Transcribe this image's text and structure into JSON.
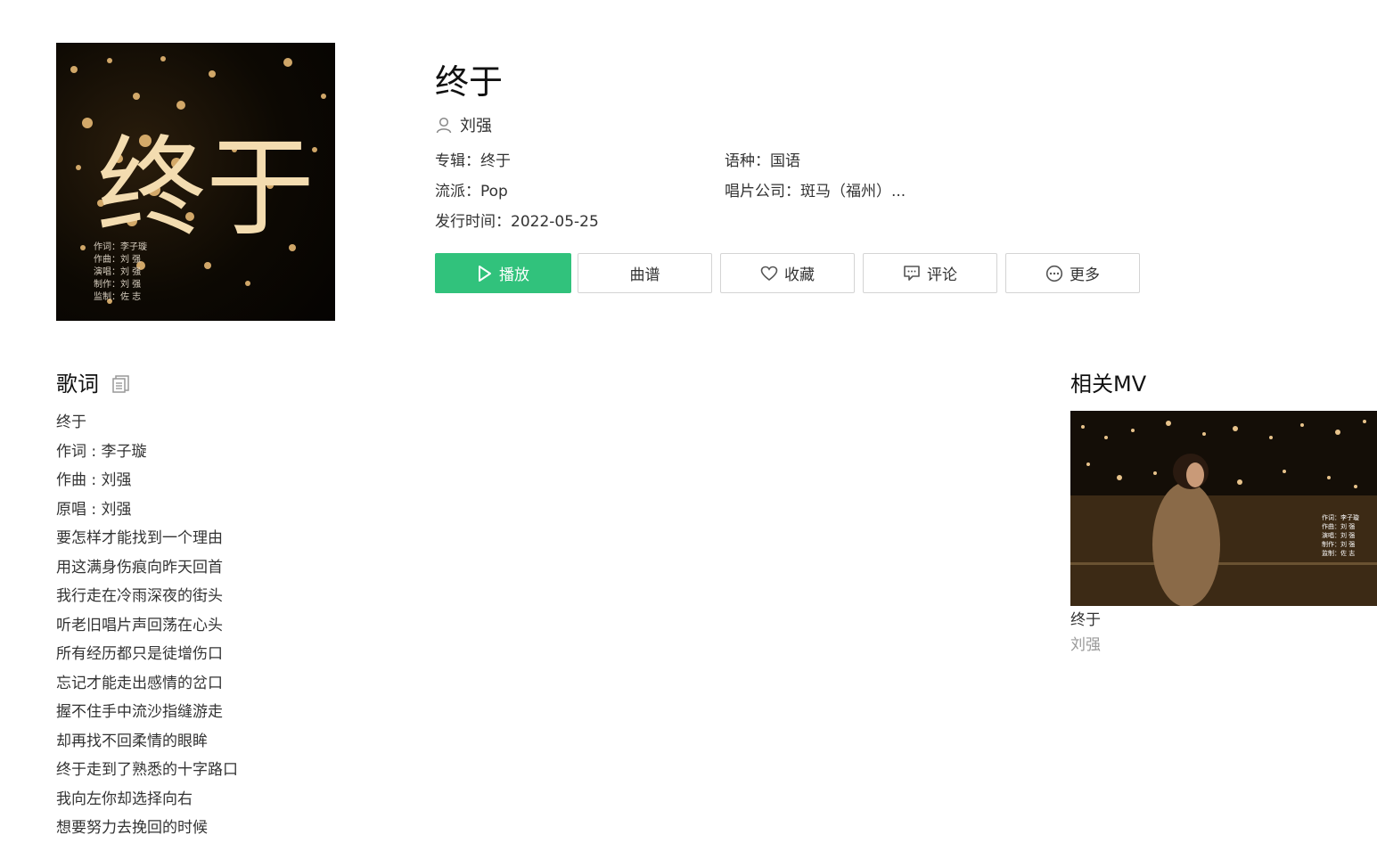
{
  "song": {
    "title": "终于",
    "singer": "刘强",
    "album_label": "专辑：",
    "album": "终于",
    "language_label": "语种：",
    "language": "国语",
    "genre_label": "流派：",
    "genre": "Pop",
    "company_label": "唱片公司：",
    "company": "斑马（福州）...",
    "release_label": "发行时间：",
    "release_date": "2022-05-25"
  },
  "cover": {
    "big_text": "终于",
    "credits": [
      "作词：李子璇",
      "作曲：刘 强",
      "演唱：刘 强",
      "制作：刘 强",
      "监制：佐 志"
    ]
  },
  "actions": {
    "play": "播放",
    "score": "曲谱",
    "favorite": "收藏",
    "comment": "评论",
    "more": "更多"
  },
  "lyrics": {
    "heading": "歌词",
    "lines": [
      "终于",
      "作词 : 李子璇",
      "作曲 : 刘强",
      "原唱 : 刘强",
      "要怎样才能找到一个理由",
      "用这满身伤痕向昨天回首",
      "我行走在冷雨深夜的街头",
      "听老旧唱片声回荡在心头",
      "所有经历都只是徒增伤口",
      "忘记才能走出感情的岔口",
      "握不住手中流沙指缝游走",
      "却再找不回柔情的眼眸",
      "终于走到了熟悉的十字路口",
      "我向左你却选择向右",
      "想要努力去挽回的时候"
    ]
  },
  "related_mv": {
    "heading": "相关MV",
    "items": [
      {
        "name": "终于",
        "singer": "刘强",
        "credits": [
          "作词：李子璇",
          "作曲：刘 强",
          "演唱：刘 强",
          "制作：刘 强",
          "监制：佐 志"
        ]
      }
    ]
  },
  "colors": {
    "accent": "#31c27c",
    "text": "#333333",
    "muted": "#999999",
    "border": "#d4d4d4"
  },
  "icons": {
    "singer": "user-icon",
    "play": "play-icon",
    "favorite": "heart-icon",
    "comment": "comment-icon",
    "more": "more-icon",
    "copy": "copy-icon"
  }
}
